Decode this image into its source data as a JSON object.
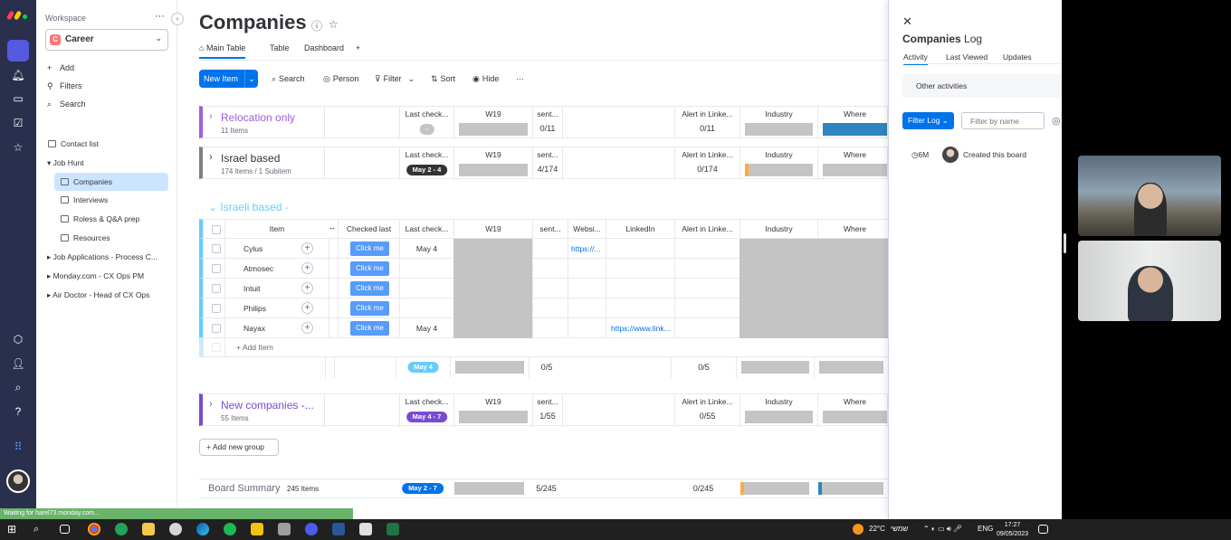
{
  "workspace": {
    "label": "Workspace",
    "name": "Career",
    "badge": "C",
    "actions": [
      "Add",
      "Filters",
      "Search"
    ],
    "tree": {
      "contact_list": "Contact list",
      "job_hunt": "Job Hunt",
      "companies": "Companies",
      "interviews": "Interviews",
      "roless": "Roless & Q&A prep",
      "resources": "Resources",
      "job_apps": "Job Applications - Process C...",
      "monday": "Monday.com - CX Ops PM",
      "airdoctor": "Air Doctor - Head of CX Ops"
    }
  },
  "board": {
    "title": "Companies",
    "tabs": [
      "Main Table",
      "Table",
      "Dashboard",
      "+"
    ],
    "new_item": "New Item",
    "toolbar": [
      "Search",
      "Person",
      "Filter",
      "Sort",
      "Hide",
      "···"
    ]
  },
  "columns": {
    "last_checked": "Last check...",
    "w19": "W19",
    "sent": "sent...",
    "alert": "Alert in Linke...",
    "industry": "Industry",
    "where": "Where",
    "item": "Item",
    "checked_last": "Checked last",
    "website": "Websi...",
    "linkedin": "LinkedIn"
  },
  "groups": {
    "relocation": {
      "name": "Relocation only",
      "sub": "11 Items",
      "pill": "-",
      "sent": "0/11",
      "alert": "0/11",
      "color": "#a25ddc"
    },
    "israel": {
      "name": "Israel based",
      "sub": "174 Items / 1 Subitem",
      "pill": "May 2 - 4",
      "sent": "4/174",
      "alert": "0/174",
      "color": "#808080"
    },
    "israeli": {
      "name": "Israeli based -",
      "color": "#66ccff"
    },
    "newco": {
      "name": "New companies -...",
      "sub": "55 Items",
      "pill": "May 4 - 7",
      "sent": "1/55",
      "alert": "0/55",
      "color": "#784bd1"
    }
  },
  "rows": [
    {
      "name": "Cylus",
      "button": "Click me",
      "date": "May 4",
      "web": "https://..."
    },
    {
      "name": "Atmosec",
      "button": "Click me",
      "date": "",
      "web": ""
    },
    {
      "name": "Intuit",
      "button": "Click me",
      "date": "",
      "web": ""
    },
    {
      "name": "Philips",
      "button": "Click me",
      "date": "",
      "web": ""
    },
    {
      "name": "Nayax",
      "button": "Click me",
      "date": "May 4",
      "web": "",
      "linkedin": "https://www.link..."
    }
  ],
  "add_item": "+ Add Item",
  "israeli_footer": {
    "pill": "May 4",
    "sent": "0/5",
    "alert": "0/5"
  },
  "add_group": "Add new group",
  "summary": {
    "label": "Board Summary",
    "count": "245 Items",
    "pill": "May 2 - 7",
    "sent": "5/245",
    "alert": "0/245"
  },
  "panel": {
    "title_bold": "Companies",
    "title_rest": "Log",
    "tabs": [
      "Activity",
      "Last Viewed",
      "Updates"
    ],
    "other": "Other activities",
    "filter_log": "Filter Log",
    "filter_placeholder": "Filter by name",
    "log_time": "6M",
    "log_text": "Created this board"
  },
  "status_bar": "Waiting for harel73.monday.com...",
  "taskbar": {
    "weather": "22°C",
    "weather_word": "שמשי",
    "lang": "ENG",
    "time": "17:27",
    "date": "09/05/2023"
  }
}
